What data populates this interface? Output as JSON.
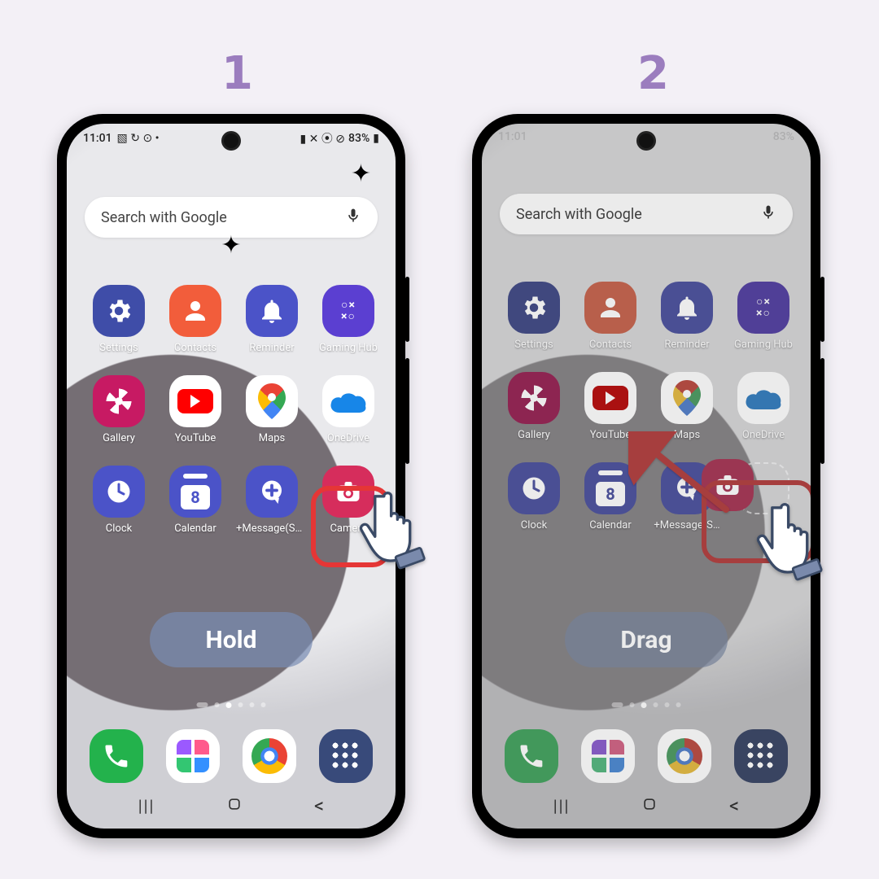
{
  "steps": {
    "one": "1",
    "two": "2"
  },
  "status": {
    "time": "11:01",
    "battery": "83%"
  },
  "search": {
    "placeholder": "Search with Google"
  },
  "apps": {
    "settings": "Settings",
    "contacts": "Contacts",
    "reminder": "Reminder",
    "gaming": "Gaming Hub",
    "gallery": "Gallery",
    "youtube": "YouTube",
    "maps": "Maps",
    "onedrive": "OneDrive",
    "clock": "Clock",
    "calendar": "Calendar",
    "calendar_num": "8",
    "message": "+Message(SM…",
    "message2": "+Message(S…",
    "camera": "Camera",
    "gaming_glyph": "○×\n×○"
  },
  "actions": {
    "hold": "Hold",
    "drag": "Drag"
  },
  "nav": {
    "recent": "|||",
    "home": "◯",
    "back": "⟨"
  }
}
